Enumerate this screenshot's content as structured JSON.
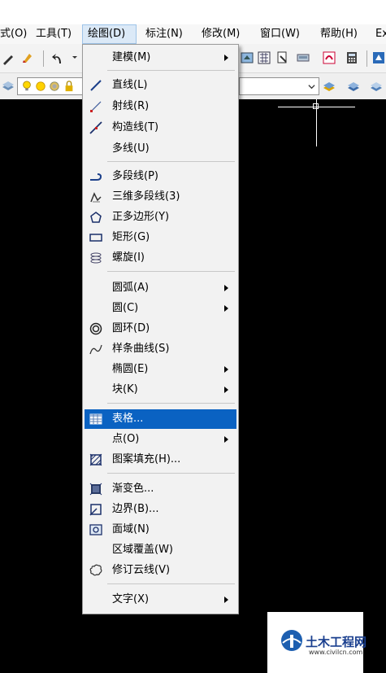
{
  "menubar": {
    "items": [
      {
        "label": "式(O)"
      },
      {
        "label": "工具(T)"
      },
      {
        "label": "绘图(D)"
      },
      {
        "label": "标注(N)"
      },
      {
        "label": "修改(M)"
      },
      {
        "label": "窗口(W)"
      },
      {
        "label": "帮助(H)"
      },
      {
        "label": "Ex"
      }
    ]
  },
  "draw_menu": {
    "items": [
      {
        "label": "建模(M)",
        "icon": "none",
        "submenu": true
      },
      {
        "label": "直线(L)",
        "icon": "line-icon"
      },
      {
        "label": "射线(R)",
        "icon": "ray-icon"
      },
      {
        "label": "构造线(T)",
        "icon": "construction-line-icon"
      },
      {
        "label": "多线(U)",
        "icon": "none"
      },
      {
        "label": "多段线(P)",
        "icon": "polyline-icon"
      },
      {
        "label": "三维多段线(3)",
        "icon": "3d-polyline-icon"
      },
      {
        "label": "正多边形(Y)",
        "icon": "polygon-icon"
      },
      {
        "label": "矩形(G)",
        "icon": "rectangle-icon"
      },
      {
        "label": "螺旋(I)",
        "icon": "helix-icon"
      },
      {
        "label": "圆弧(A)",
        "icon": "none",
        "submenu": true
      },
      {
        "label": "圆(C)",
        "icon": "none",
        "submenu": true
      },
      {
        "label": "圆环(D)",
        "icon": "donut-icon"
      },
      {
        "label": "样条曲线(S)",
        "icon": "spline-icon"
      },
      {
        "label": "椭圆(E)",
        "icon": "none",
        "submenu": true
      },
      {
        "label": "块(K)",
        "icon": "none",
        "submenu": true
      },
      {
        "label": "表格...",
        "icon": "table-icon",
        "highlighted": true
      },
      {
        "label": "点(O)",
        "icon": "none",
        "submenu": true
      },
      {
        "label": "图案填充(H)...",
        "icon": "hatch-icon"
      },
      {
        "label": "渐变色...",
        "icon": "gradient-icon"
      },
      {
        "label": "边界(B)...",
        "icon": "boundary-icon"
      },
      {
        "label": "面域(N)",
        "icon": "region-icon"
      },
      {
        "label": "区域覆盖(W)",
        "icon": "none"
      },
      {
        "label": "修订云线(V)",
        "icon": "revcloud-icon"
      },
      {
        "label": "文字(X)",
        "icon": "none",
        "submenu": true
      }
    ]
  },
  "logo": {
    "text": "土木工程网",
    "url": "www.civilcn.com"
  },
  "colors": {
    "highlight": "#0a62c2",
    "canvas": "#000000",
    "menu_bg": "#f2f2f2"
  }
}
